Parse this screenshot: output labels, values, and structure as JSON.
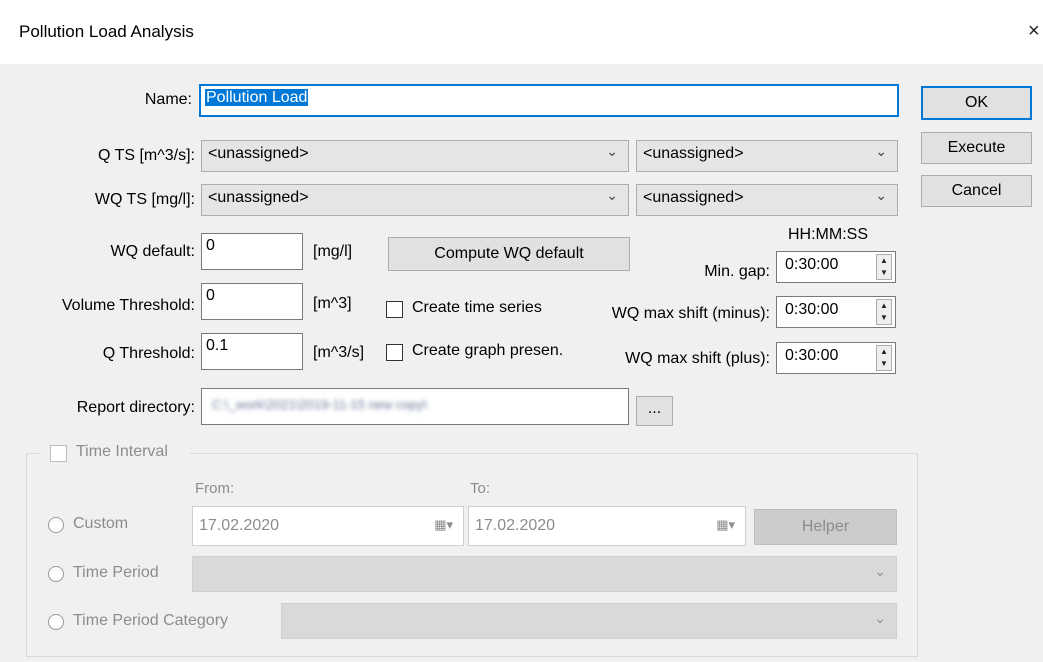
{
  "window": {
    "title": "Pollution Load Analysis",
    "close_glyph": "×"
  },
  "form": {
    "name_label": "Name:",
    "name_value": "Pollution Load",
    "q_ts_label": "Q TS [m^3/s]:",
    "q_ts_value": "<unassigned>",
    "q_ts_value2": "<unassigned>",
    "wq_ts_label": "WQ TS [mg/l]:",
    "wq_ts_value": "<unassigned>",
    "wq_ts_value2": "<unassigned>",
    "wq_default_label": "WQ default:",
    "wq_default_value": "0",
    "wq_default_unit": "[mg/l]",
    "compute_button": "Compute WQ default",
    "volume_threshold_label": "Volume Threshold:",
    "volume_threshold_value": "0",
    "volume_threshold_unit": "[m^3]",
    "create_ts_label": "Create time series",
    "q_threshold_label": "Q Threshold:",
    "q_threshold_value": "0.1",
    "q_threshold_unit": "[m^3/s]",
    "create_graph_label": "Create graph presen.",
    "hhmmss_label": "HH:MM:SS",
    "min_gap_label": "Min. gap:",
    "min_gap_value": "0:30:00",
    "wq_shift_minus_label": "WQ max shift (minus):",
    "wq_shift_minus_value": "0:30:00",
    "wq_shift_plus_label": "WQ max shift (plus):",
    "wq_shift_plus_value": "0:30:00",
    "report_dir_label": "Report directory:",
    "report_dir_value": "C:\\_work\\2021\\2019-11-15 new copy\\",
    "browse_button": "..."
  },
  "time_interval": {
    "label": "Time Interval",
    "from_label": "From:",
    "to_label": "To:",
    "custom_label": "Custom",
    "from_value": "17.02.2020",
    "to_value": "17.02.2020",
    "helper_button": "Helper",
    "time_period_label": "Time Period",
    "time_period_category_label": "Time Period Category"
  },
  "buttons": {
    "ok": "OK",
    "execute": "Execute",
    "cancel": "Cancel"
  },
  "colors": {
    "accent": "#0078d7",
    "disabled_text": "#8c8c8c",
    "selection": "#0078d7"
  }
}
